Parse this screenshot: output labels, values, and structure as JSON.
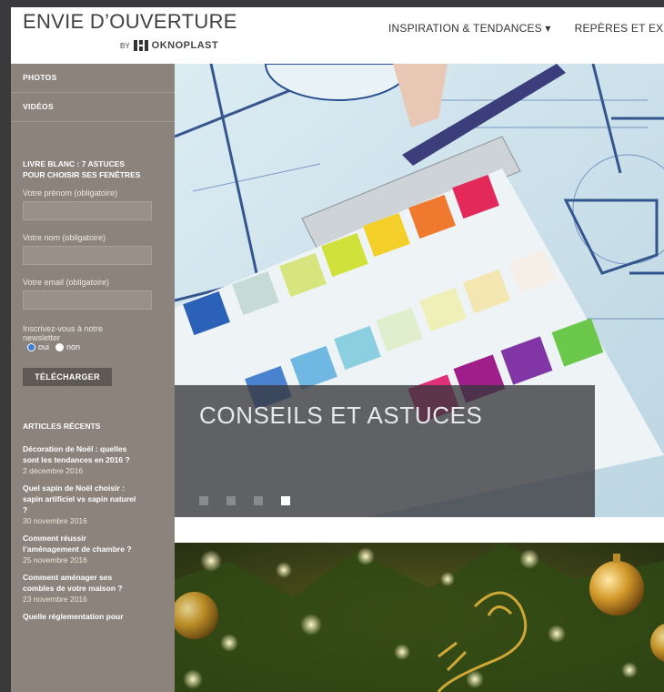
{
  "header": {
    "logo_title": "ENVIE D’OUVERTURE",
    "logo_by": "BY",
    "logo_brand": "OKNOPLAST",
    "nav": [
      "INSPIRATION & TENDANCES ▾",
      "REPÈRES ET EX"
    ]
  },
  "sidebar": {
    "links": [
      "PHOTOS",
      "VIDÉOS"
    ],
    "whitepaper": {
      "title_line1": "LIVRE BLANC : 7 ASTUCES",
      "title_line2": "POUR CHOISIR SES FENÊTRES",
      "firstname_label": "Votre prénom (obligatoire)",
      "lastname_label": "Votre nom (obligatoire)",
      "email_label": "Votre email (obligatoire)",
      "newsletter_line1": "Inscrivez-vous à notre",
      "newsletter_line2": "newsletter",
      "yes": "oui",
      "no": "non",
      "download": "TÉLÉCHARGER"
    },
    "recent_title": "ARTICLES RÉCENTS",
    "articles": [
      {
        "l1": "Décoration de Noël : quelles",
        "l2": "sont les tendances en 2016 ?",
        "date": "2 décembre 2016"
      },
      {
        "l1": "Quel sapin de Noël choisir :",
        "l2": "sapin artificiel vs sapin naturel",
        "l3": "?",
        "date": "30 novembre 2016"
      },
      {
        "l1": "Comment réussir",
        "l2": "l’aménagement de chambre ?",
        "date": "25 novembre 2016"
      },
      {
        "l1": "Comment aménager ses",
        "l2": "combles de votre maison ?",
        "date": "23 novembre 2016"
      },
      {
        "l1": "Quelle réglementation pour"
      }
    ]
  },
  "hero": {
    "caption": "CONSEILS ET ASTUCES",
    "slides": 4,
    "active_slide": 4
  },
  "colors": {
    "sidebar_bg": "#8c847c",
    "caption_bg": "#37373c",
    "button_bg": "#5f5955"
  }
}
